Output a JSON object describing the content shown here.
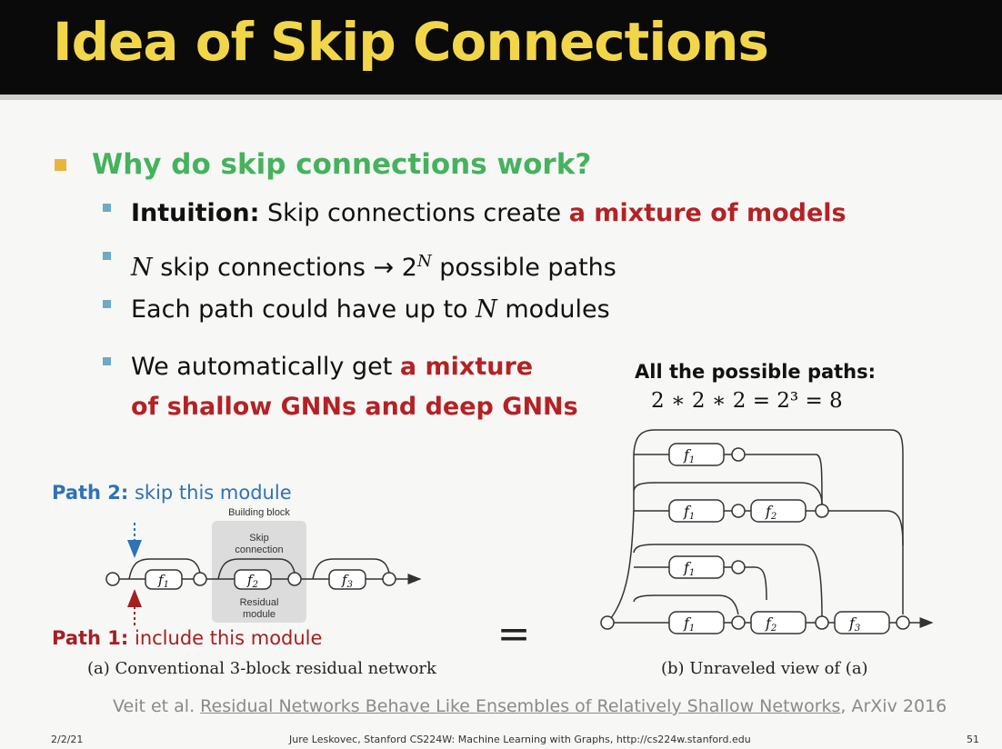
{
  "slide": {
    "title": "Idea of Skip Connections",
    "bullet1": "Why do skip connections work?",
    "sub1_bold": "Intuition:",
    "sub1_plain": " Skip connections create ",
    "sub1_red": "a mixture of models",
    "sub2_n": "N",
    "sub2_mid": " skip connections → 2",
    "sub2_sup": "N",
    "sub2_end": " possible paths",
    "sub3_pre": "Each path could have up to ",
    "sub3_n": "N",
    "sub3_end": " modules",
    "sub4_pre": "We automatically get ",
    "sub4_red1": "a mixture",
    "sub4_red2": "of shallow GNNs and deep GNNs"
  },
  "figure_a": {
    "path2_bold": "Path 2:",
    "path2_text": " skip this module",
    "path1_bold": "Path 1:",
    "path1_text": " include this module",
    "building_block": "Building block",
    "skip_line1": "Skip",
    "skip_line2": "connection",
    "residual_line1": "Residual",
    "residual_line2": "module",
    "f1": "f",
    "f1_sub": "1",
    "f2": "f",
    "f2_sub": "2",
    "f3": "f",
    "f3_sub": "3",
    "caption": "(a) Conventional 3-block residual network"
  },
  "equals_sign": "=",
  "figure_b": {
    "heading": "All the possible paths:",
    "formula": "2 ∗ 2 ∗ 2 = 2³ = 8",
    "caption": "(b) Unraveled view of (a)"
  },
  "citation": {
    "author": "Veit et al. ",
    "link_text": "Residual Networks Behave Like Ensembles of Relatively Shallow Networks",
    "venue": ", ArXiv 2016"
  },
  "footer": {
    "date": "2/2/21",
    "course": "Jure Leskovec, Stanford CS224W: Machine Learning with Graphs, http://cs224w.stanford.edu",
    "page": "51"
  },
  "colors": {
    "title": "#f2d64a",
    "green": "#45b25d",
    "red": "#b32225",
    "blue": "#2f72b5"
  }
}
